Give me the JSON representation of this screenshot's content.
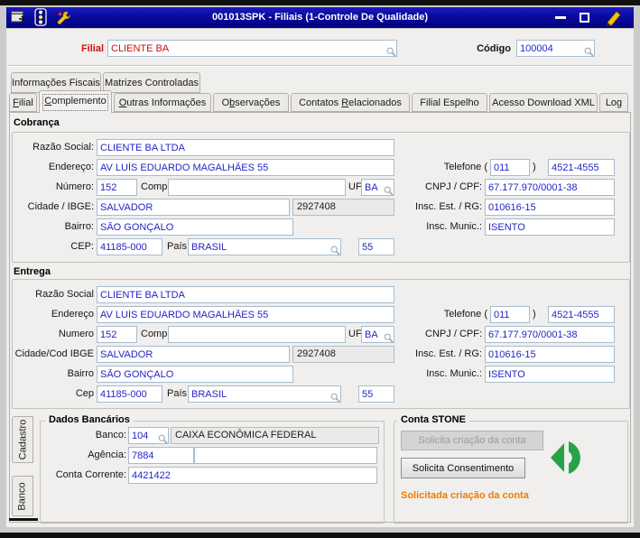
{
  "window": {
    "title": "001013SPK - Filiais (1-Controle De Qualidade)"
  },
  "icons": {
    "titlebar_left": [
      "form-window-icon",
      "traffic-light-icon",
      "wrench-icon"
    ],
    "titlebar_right": [
      "minimize-icon",
      "maximize-icon",
      "edit-pencil-icon"
    ],
    "input_suffix": "magnifier-icon",
    "stone": "stone-logo-icon"
  },
  "colors": {
    "titlebar_blue": "#0a0a9e",
    "label_red": "#cc1111",
    "value_blue": "#2424c8",
    "status_orange": "#ee7c00",
    "stone_green": "#27a245"
  },
  "header": {
    "filial_label": "Filial",
    "filial_value": "CLIENTE BA",
    "codigo_label": "Código",
    "codigo_value": "100004"
  },
  "tabs": {
    "top": [
      "Informações Fiscais",
      "Matrizes Controladas"
    ],
    "main": [
      {
        "html": "<u>F</u>ilial",
        "label": "Filial"
      },
      {
        "html": "<u>C</u>omplemento",
        "label": "Complemento",
        "active": true
      },
      {
        "html": "<u>O</u>utras Informações",
        "label": "Outras Informações"
      },
      {
        "html": "O<u>b</u>servações",
        "label": "Observações"
      },
      {
        "html": "Contatos <u>R</u>elacionados",
        "label": "Contatos Relacionados"
      },
      {
        "html": "Filial Espelho",
        "label": "Filial Espelho"
      },
      {
        "html": "Acesso Download XML",
        "label": "Acesso Download XML"
      },
      {
        "html": "Log",
        "label": "Log"
      }
    ]
  },
  "cobranca": {
    "title": "Cobrança",
    "labels": {
      "razao": "Razão Social:",
      "endereco": "Endereço:",
      "numero": "Número:",
      "compl": "Compl.",
      "uf": "UF",
      "cidade": "Cidade / IBGE:",
      "bairro": "Bairro:",
      "cep": "CEP:",
      "pais": "País",
      "telefone": "Telefone (",
      "telefone_close": ")",
      "cnpj": "CNPJ / CPF:",
      "insc_est": "Insc. Est. / RG:",
      "insc_mun": "Insc. Munic.:"
    },
    "values": {
      "razao": "CLIENTE BA LTDA",
      "endereco": "AV LUÍS EDUARDO MAGALHÃES 55",
      "numero": "152",
      "compl": "",
      "uf": "BA",
      "cidade": "SALVADOR",
      "ibge": "2927408",
      "bairro": "SÃO GONÇALO",
      "cep": "41185-000",
      "pais": "BRASIL",
      "pais_cod": "55",
      "ddd": "011",
      "telefone": "4521-4555",
      "cnpj": "67.177.970/0001-38",
      "insc_est": "010616-15",
      "insc_mun": "ISENTO"
    }
  },
  "entrega": {
    "title": "Entrega",
    "labels": {
      "razao": "Razão Social",
      "endereco": "Endereço",
      "numero": "Numero",
      "compl": "Compl.",
      "uf": "UF",
      "cidade": "Cidade/Cod IBGE",
      "bairro": "Bairro",
      "cep": "Cep",
      "pais": "País",
      "telefone": "Telefone (",
      "telefone_close": ")",
      "cnpj": "CNPJ / CPF:",
      "insc_est": "Insc. Est. / RG:",
      "insc_mun": "Insc. Munic.:"
    },
    "values": {
      "razao": "CLIENTE BA LTDA",
      "endereco": "AV LUÍS EDUARDO MAGALHÃES 55",
      "numero": "152",
      "compl": "",
      "uf": "BA",
      "cidade": "SALVADOR",
      "ibge": "2927408",
      "bairro": "SÃO GONÇALO",
      "cep": "41185-000",
      "pais": "BRASIL",
      "pais_cod": "55",
      "ddd": "011",
      "telefone": "4521-4555",
      "cnpj": "67.177.970/0001-38",
      "insc_est": "010616-15",
      "insc_mun": "ISENTO"
    }
  },
  "side_tabs": [
    {
      "label": "Cadastro"
    },
    {
      "label": "Banco"
    }
  ],
  "dados_bancarios": {
    "title": "Dados Bancários",
    "labels": {
      "banco": "Banco:",
      "agencia": "Agência:",
      "conta": "Conta Corrente:"
    },
    "values": {
      "banco_cod": "104",
      "banco_nome": "CAIXA ECONÔMICA FEDERAL",
      "agencia": "7884",
      "agencia_extra": "",
      "conta": "4421422"
    }
  },
  "conta_stone": {
    "title": "Conta STONE",
    "buttons": {
      "criacao": "Solicita criação da conta",
      "consentimento": "Solicita Consentimento"
    },
    "status": "Solicitada criação da conta"
  }
}
